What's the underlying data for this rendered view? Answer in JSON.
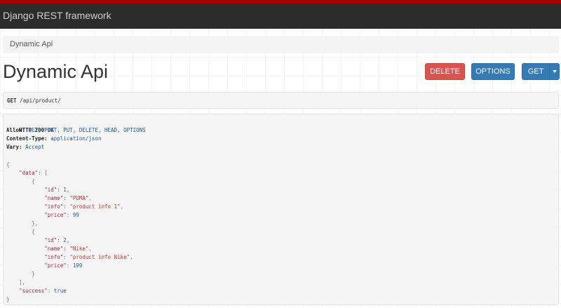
{
  "navbar": {
    "brand": "Django REST framework"
  },
  "breadcrumb": {
    "items": [
      "Dynamic Api"
    ]
  },
  "page": {
    "title": "Dynamic Api"
  },
  "buttons": {
    "delete": "DELETE",
    "options": "OPTIONS",
    "get": "GET"
  },
  "request": {
    "method": "GET",
    "path": "/api/product/"
  },
  "response": {
    "status": "HTTP 200 OK",
    "headers": [
      {
        "key": "Allow:",
        "value": "GET, POST, PUT, DELETE, HEAD, OPTIONS"
      },
      {
        "key": "Content-Type:",
        "value": "application/json"
      },
      {
        "key": "Vary:",
        "value": "Accept"
      }
    ],
    "body": {
      "open_brace": "{",
      "close_brace": "}",
      "data_key": "\"data\"",
      "open_bracket": "[",
      "close_bracket": "],",
      "items": [
        {
          "id": "1",
          "name": "\"PUMA\"",
          "info": "\"product info 1\"",
          "price": "99",
          "close": "},"
        },
        {
          "id": "2",
          "name": "\"Nike\"",
          "info": "\"product info Nike\"",
          "price": "199",
          "close": "}"
        }
      ],
      "success_key": "\"success\"",
      "success_value": "true",
      "labels": {
        "id": "\"id\"",
        "name": "\"name\"",
        "info": "\"info\"",
        "price": "\"price\""
      }
    }
  },
  "colors": {
    "navbar_bg": "#2c2c2c",
    "navbar_accent": "#a30000",
    "delete_btn": "#d9534f",
    "primary_btn": "#337ab7"
  }
}
